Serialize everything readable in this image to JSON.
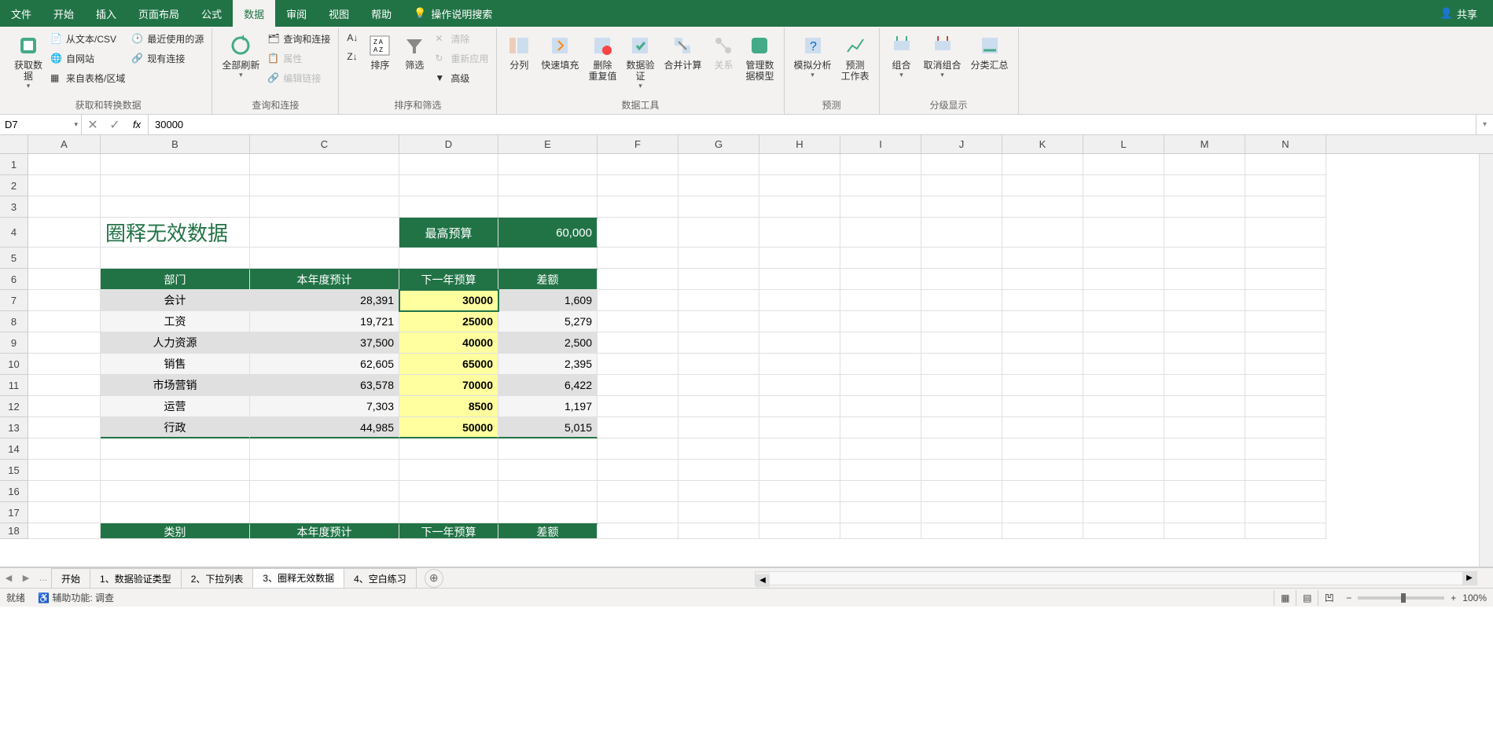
{
  "menu": {
    "file": "文件",
    "home": "开始",
    "insert": "插入",
    "layout": "页面布局",
    "formula": "公式",
    "data": "数据",
    "review": "审阅",
    "view": "视图",
    "help": "帮助",
    "tell_me": "操作说明搜索",
    "share": "共享"
  },
  "ribbon": {
    "get_data": "获取数\n据",
    "from_text_csv": "从文本/CSV",
    "from_web": "自网站",
    "from_table": "来自表格/区域",
    "recent_sources": "最近使用的源",
    "existing_conn": "现有连接",
    "group1_label": "获取和转换数据",
    "refresh_all": "全部刷新",
    "queries_conn": "查询和连接",
    "properties": "属性",
    "edit_links": "编辑链接",
    "group2_label": "查询和连接",
    "sort_asc": "A→Z",
    "sort": "排序",
    "filter": "筛选",
    "clear": "清除",
    "reapply": "重新应用",
    "advanced": "高级",
    "group3_label": "排序和筛选",
    "text_to_cols": "分列",
    "flash_fill": "快速填充",
    "remove_dup": "删除\n重复值",
    "data_valid": "数据验\n证",
    "consolidate": "合并计算",
    "relationships": "关系",
    "manage_model": "管理数\n据模型",
    "group4_label": "数据工具",
    "whatif": "模拟分析",
    "forecast": "预测\n工作表",
    "group5_label": "预测",
    "group": "组合",
    "ungroup": "取消组合",
    "subtotal": "分类汇总",
    "group6_label": "分级显示"
  },
  "namebox": {
    "ref": "D7"
  },
  "formula": {
    "value": "30000",
    "fx": "fx"
  },
  "columns": [
    "A",
    "B",
    "C",
    "D",
    "E",
    "F",
    "G",
    "H",
    "I",
    "J",
    "K",
    "L",
    "M",
    "N"
  ],
  "col_widths_first5": [
    92,
    190,
    190,
    126,
    126
  ],
  "default_col_width": 103,
  "sheet": {
    "title": "圈释无效数据",
    "max_label": "最高预算",
    "max_value": "60,000",
    "headers": {
      "dept": "部门",
      "est": "本年度预计",
      "budget": "下一年预算",
      "diff": "差额"
    },
    "rows": [
      {
        "dept": "会计",
        "est": "28,391",
        "budget": "30000",
        "diff": "1,609"
      },
      {
        "dept": "工资",
        "est": "19,721",
        "budget": "25000",
        "diff": "5,279"
      },
      {
        "dept": "人力资源",
        "est": "37,500",
        "budget": "40000",
        "diff": "2,500"
      },
      {
        "dept": "销售",
        "est": "62,605",
        "budget": "65000",
        "diff": "2,395"
      },
      {
        "dept": "市场营销",
        "est": "63,578",
        "budget": "70000",
        "diff": "6,422"
      },
      {
        "dept": "运营",
        "est": "7,303",
        "budget": "8500",
        "diff": "1,197"
      },
      {
        "dept": "行政",
        "est": "44,985",
        "budget": "50000",
        "diff": "5,015"
      }
    ],
    "headers2": {
      "cat": "类别",
      "est": "本年度预计",
      "budget": "下一年预算",
      "diff": "差额"
    }
  },
  "tabs": {
    "start": "开始",
    "t1": "1、数据验证类型",
    "t2": "2、下拉列表",
    "t3": "3、圈释无效数据",
    "t4": "4、空白练习"
  },
  "status": {
    "ready": "就绪",
    "accessibility": "辅助功能: 调查",
    "zoom": "100%"
  }
}
